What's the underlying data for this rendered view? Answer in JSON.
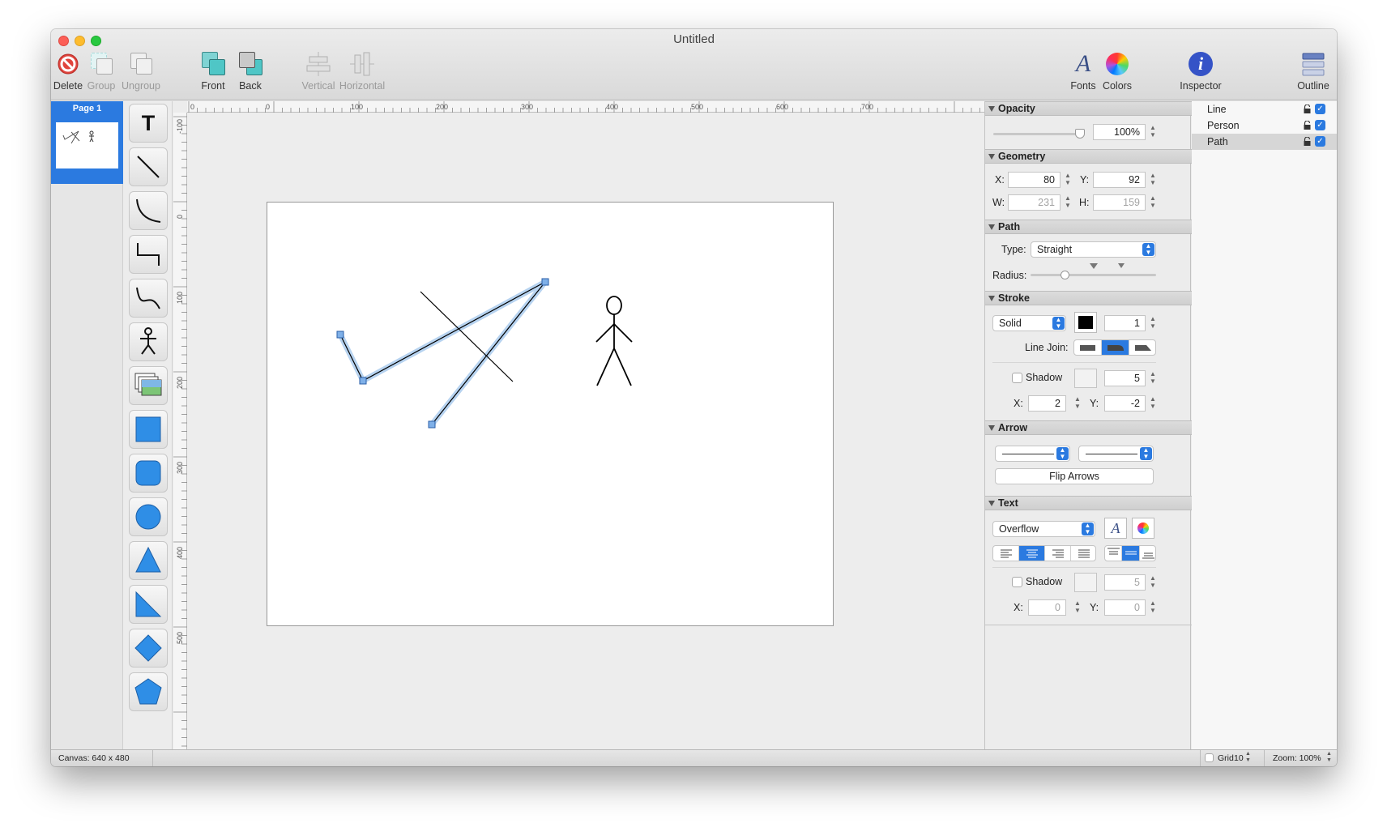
{
  "window": {
    "title": "Untitled"
  },
  "toolbar": {
    "delete": "Delete",
    "group": "Group",
    "ungroup": "Ungroup",
    "front": "Front",
    "back": "Back",
    "vertical": "Vertical",
    "horizontal": "Horizontal",
    "fonts": "Fonts",
    "colors": "Colors",
    "inspector": "Inspector",
    "outline": "Outline",
    "fonts_glyph": "A",
    "inspector_glyph": "i"
  },
  "pages": {
    "current": "Page 1"
  },
  "tools": [
    "text-tool",
    "line-tool",
    "curve-tool",
    "elbow-tool",
    "bezier-tool",
    "person-tool",
    "image-tool",
    "rectangle-tool",
    "rounded-rectangle-tool",
    "circle-tool",
    "triangle-tool",
    "right-triangle-tool",
    "diamond-tool",
    "pentagon-tool"
  ],
  "tool_text_glyph": "T",
  "ruler": {
    "top_labels": [
      "0",
      "0",
      "100",
      "200",
      "300",
      "400",
      "500",
      "600",
      "700"
    ],
    "left_labels": [
      "-100",
      "0",
      "100",
      "200",
      "300",
      "400",
      "500"
    ]
  },
  "inspector": {
    "opacity": {
      "header": "Opacity",
      "value": "100%"
    },
    "geometry": {
      "header": "Geometry",
      "x_label": "X:",
      "x": "80",
      "y_label": "Y:",
      "y": "92",
      "w_label": "W:",
      "w": "231",
      "h_label": "H:",
      "h": "159"
    },
    "path": {
      "header": "Path",
      "type_label": "Type:",
      "type": "Straight",
      "radius_label": "Radius:"
    },
    "stroke": {
      "header": "Stroke",
      "style": "Solid",
      "color": "#000000",
      "width": "1",
      "line_join_label": "Line Join:",
      "shadow_label": "Shadow",
      "shadow_blur": "5",
      "x_label": "X:",
      "x": "2",
      "y_label": "Y:",
      "y": "-2"
    },
    "arrow": {
      "header": "Arrow",
      "flip_label": "Flip Arrows"
    },
    "text": {
      "header": "Text",
      "overflow": "Overflow",
      "shadow_label": "Shadow",
      "shadow_blur": "5",
      "x_label": "X:",
      "x": "0",
      "y_label": "Y:",
      "y": "0",
      "font_glyph": "A"
    }
  },
  "outline": {
    "items": [
      {
        "label": "Line",
        "selected": false
      },
      {
        "label": "Person",
        "selected": false
      },
      {
        "label": "Path",
        "selected": true
      }
    ]
  },
  "status": {
    "canvas": "Canvas: 640 x 480",
    "grid": "Grid",
    "grid_value": "10",
    "zoom": "Zoom: 100%"
  },
  "colors": {
    "accent": "#2b7ae0",
    "shape_fill": "#2f8ee6",
    "selection_halo": "#b7d3f0"
  }
}
